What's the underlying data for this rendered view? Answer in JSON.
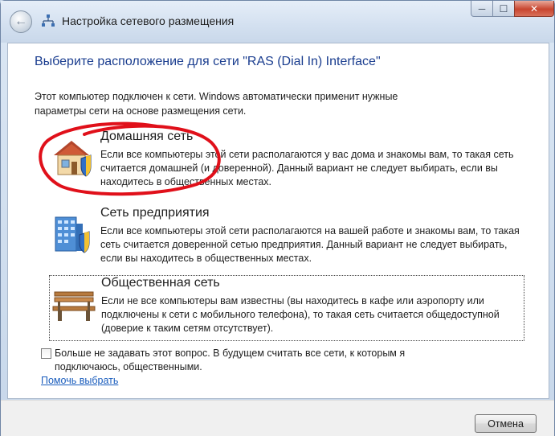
{
  "window": {
    "title": "Настройка сетевого размещения",
    "minimize": "─",
    "maximize": "☐",
    "close": "✕"
  },
  "heading": "Выберите расположение для сети \"RAS (Dial In) Interface\"",
  "intro": "Этот компьютер подключен к сети. Windows автоматически применит нужные параметры сети на основе размещения сети.",
  "options": [
    {
      "title": "Домашняя сеть",
      "description": "Если все компьютеры этой сети располагаются у вас дома и знакомы вам, то такая сеть считается домашней (и доверенной). Данный вариант не следует выбирать, если вы находитесь в общественных местах.",
      "icon": "house-shield-icon"
    },
    {
      "title": "Сеть предприятия",
      "description": "Если все компьютеры этой сети располагаются на вашей работе и знакомы вам, то такая сеть считается доверенной сетью предприятия. Данный вариант не следует выбирать, если вы находитесь в общественных местах.",
      "icon": "office-building-shield-icon"
    },
    {
      "title": "Общественная сеть",
      "description": "Если не все компьютеры вам известны (вы находитесь в кафе или аэропорту или подключены к сети с мобильного телефона), то такая сеть считается общедоступной (доверие к таким сетям отсутствует).",
      "icon": "park-bench-icon"
    }
  ],
  "checkbox": {
    "label": "Больше не задавать этот вопрос. В будущем считать все сети, к которым я подключаюсь, общественными.",
    "checked": false
  },
  "help_link": "Помочь выбрать",
  "cancel_label": "Отмена",
  "colors": {
    "heading": "#1a3d8f",
    "link": "#1a5dbd",
    "annotation": "#e0101a"
  }
}
